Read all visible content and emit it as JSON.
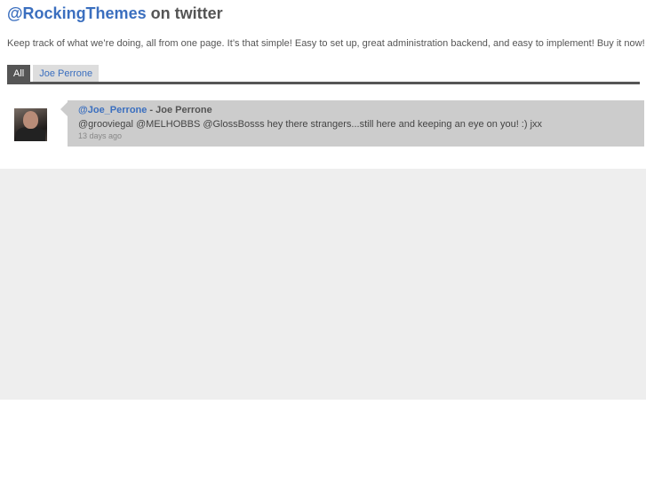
{
  "header": {
    "handle": "@RockingThemes",
    "suffix": " on twitter"
  },
  "intro": "Keep track of what we’re doing, all from one page. It’s that simple! Easy to set up, great administration backend, and easy to implement! Buy it now!",
  "tabs": [
    {
      "label": "All",
      "active": true
    },
    {
      "label": "Joe Perrone",
      "active": false
    }
  ],
  "tweet": {
    "user_link": "@Joe_Perrone",
    "separator": " - ",
    "user_name": "Joe Perrone",
    "text": "@grooviegal @MELHOBBS @GlossBosss hey there strangers...still here and keeping an eye on you! :) jxx",
    "time": "13 days ago"
  },
  "colors": {
    "accent": "#3b6fbf",
    "tab_active": "#555555",
    "bubble": "#cccccc",
    "band": "#eeeeee"
  }
}
